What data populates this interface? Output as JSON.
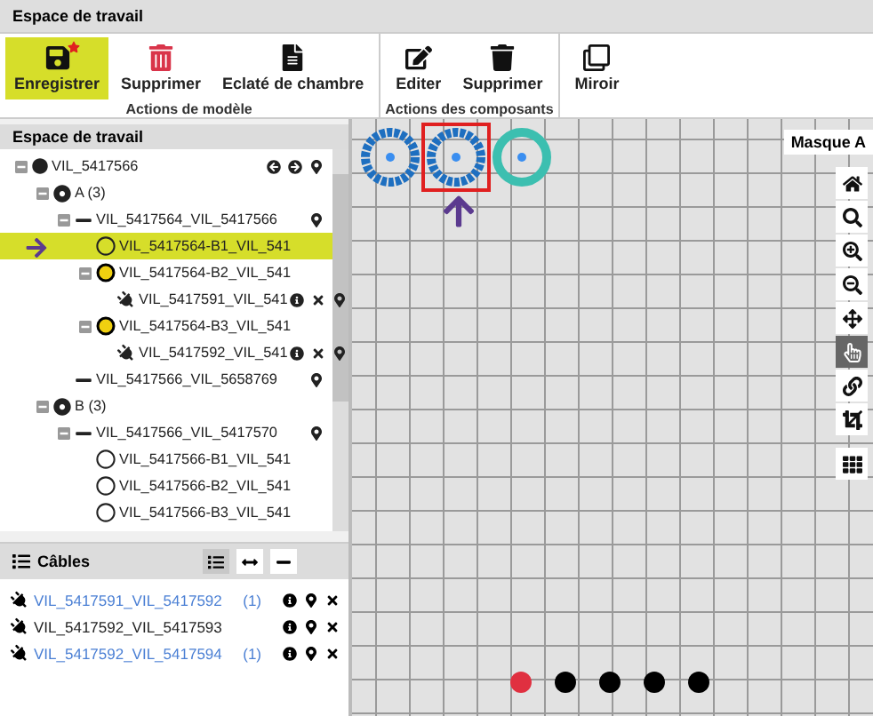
{
  "window": {
    "title": "Espace de travail"
  },
  "ribbon": {
    "groups": [
      {
        "label": "Actions de modèle",
        "buttons": [
          {
            "label": "Enregistrer",
            "kind": "save",
            "selected": true,
            "modified": true
          },
          {
            "label": "Supprimer",
            "kind": "delete-model",
            "selected": false
          },
          {
            "label": "Eclaté de chambre",
            "kind": "document",
            "selected": false
          }
        ]
      },
      {
        "label": "Actions des composants",
        "buttons": [
          {
            "label": "Editer",
            "kind": "edit",
            "selected": false
          },
          {
            "label": "Supprimer",
            "kind": "delete",
            "selected": false
          }
        ]
      },
      {
        "buttons": [
          {
            "label": "Miroir",
            "kind": "mirror",
            "selected": false
          }
        ]
      }
    ]
  },
  "tree": {
    "title": "Espace de travail",
    "items": [
      {
        "label": "VIL_5417566",
        "kind": "filled",
        "expanded": true,
        "selected": false,
        "actions": [
          {
            "kind": "back"
          },
          {
            "kind": "forward"
          },
          {
            "kind": "pin"
          }
        ],
        "children": [
          {
            "label": "A (3)",
            "kind": "target",
            "expanded": true,
            "selected": false,
            "children": [
              {
                "label": "VIL_5417564_VIL_5417566",
                "kind": "dash",
                "expanded": true,
                "selected": false,
                "actions": [
                  {
                    "kind": "pin"
                  }
                ],
                "children": [
                  {
                    "label": "VIL_5417564-B1_VIL_541",
                    "kind": "ring",
                    "selected": true
                  },
                  {
                    "label": "VIL_5417564-B2_VIL_541",
                    "kind": "ring-yellow",
                    "expanded": true,
                    "selected": false,
                    "children": [
                      {
                        "label": "VIL_5417591_VIL_541",
                        "kind": "plug",
                        "selected": false,
                        "actions": [
                          {
                            "kind": "info"
                          },
                          {
                            "kind": "remove"
                          },
                          {
                            "kind": "pin"
                          }
                        ]
                      }
                    ]
                  },
                  {
                    "label": "VIL_5417564-B3_VIL_541",
                    "kind": "ring-yellow",
                    "expanded": true,
                    "selected": false,
                    "children": [
                      {
                        "label": "VIL_5417592_VIL_541",
                        "kind": "plug",
                        "selected": false,
                        "actions": [
                          {
                            "kind": "info"
                          },
                          {
                            "kind": "remove"
                          },
                          {
                            "kind": "pin"
                          }
                        ]
                      }
                    ]
                  }
                ]
              },
              {
                "label": "VIL_5417566_VIL_5658769",
                "kind": "dash",
                "selected": false,
                "actions": [
                  {
                    "kind": "pin"
                  }
                ]
              }
            ]
          },
          {
            "label": "B (3)",
            "kind": "target",
            "expanded": true,
            "selected": false,
            "children": [
              {
                "label": "VIL_5417566_VIL_5417570",
                "kind": "dash",
                "expanded": true,
                "selected": false,
                "actions": [
                  {
                    "kind": "pin"
                  }
                ],
                "children": [
                  {
                    "label": "VIL_5417566-B1_VIL_541",
                    "kind": "ring",
                    "selected": false
                  },
                  {
                    "label": "VIL_5417566-B2_VIL_541",
                    "kind": "ring",
                    "selected": false
                  },
                  {
                    "label": "VIL_5417566-B3_VIL_541",
                    "kind": "ring",
                    "selected": false
                  }
                ]
              }
            ]
          }
        ]
      }
    ]
  },
  "cables": {
    "title": "Câbles",
    "views": [
      {
        "kind": "list",
        "selected": true
      },
      {
        "kind": "width",
        "selected": false
      },
      {
        "kind": "line",
        "selected": false
      }
    ],
    "items": [
      {
        "label": "VIL_5417591_VIL_5417592",
        "linked": true,
        "count": "(1)"
      },
      {
        "label": "VIL_5417592_VIL_5417593",
        "linked": false
      },
      {
        "label": "VIL_5417592_VIL_5417594",
        "linked": true,
        "count": "(1)"
      }
    ]
  },
  "canvas": {
    "mask": "Masque A",
    "rings": [
      {
        "kind": "hatched",
        "selected": false
      },
      {
        "kind": "hatched",
        "selected": true
      },
      {
        "kind": "teal",
        "selected": false
      }
    ],
    "tools": [
      {
        "kind": "home",
        "selected": false
      },
      {
        "kind": "search",
        "selected": false
      },
      {
        "kind": "zoom-in",
        "selected": false
      },
      {
        "kind": "zoom-out",
        "selected": false
      },
      {
        "kind": "move",
        "selected": false
      },
      {
        "kind": "pointer",
        "selected": true
      },
      {
        "kind": "link",
        "selected": false
      },
      {
        "kind": "crop",
        "selected": false
      },
      {
        "kind": "grid",
        "selected": false
      }
    ],
    "dots": [
      {
        "color": "#e03040"
      },
      {
        "color": "#000000"
      },
      {
        "color": "#000000"
      },
      {
        "color": "#000000"
      },
      {
        "color": "#000000"
      }
    ]
  }
}
